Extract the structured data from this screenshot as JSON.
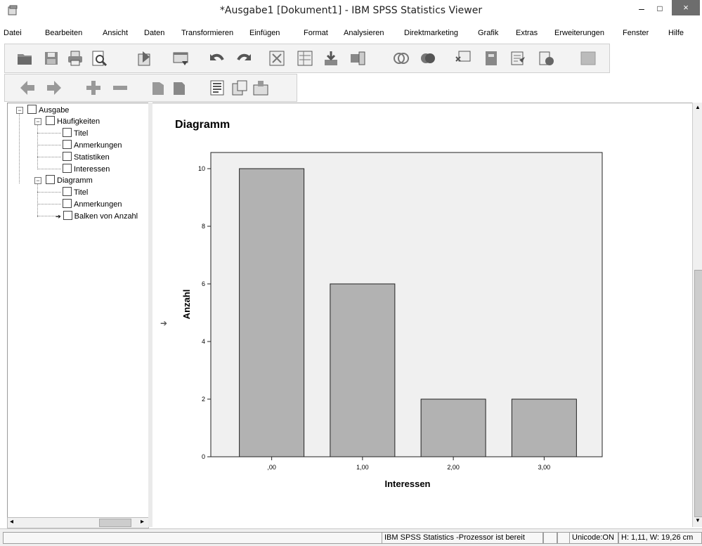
{
  "window": {
    "title": "*Ausgabe1 [Dokument1] - IBM SPSS Statistics Viewer",
    "minimize": "–",
    "maximize": "□",
    "close": "×"
  },
  "menu": [
    "Datei",
    "Bearbeiten",
    "Ansicht",
    "Daten",
    "Transformieren",
    "Einfügen",
    "Format",
    "Analysieren",
    "Direktmarketing",
    "Grafik",
    "Extras",
    "Erweiterungen",
    "Fenster",
    "Hilfe"
  ],
  "toolbar1_icons": [
    "open-icon",
    "save-icon",
    "print-icon",
    "print-preview-icon",
    "export-icon",
    "recall-dialog-icon",
    "undo-icon",
    "redo-icon",
    "goto-data-icon",
    "goto-case-icon",
    "insert-table-icon",
    "variables-icon",
    "select-cases-icon",
    "show-all-icon",
    "value-labels-icon",
    "designate-window-icon",
    "script-icon",
    "run-icon",
    "disabled-icon"
  ],
  "toolbar2_icons": [
    "promote-icon",
    "demote-icon",
    "expand-icon",
    "collapse-icon",
    "show-icon",
    "hide-icon",
    "insert-heading-icon",
    "insert-title-icon",
    "insert-text-icon"
  ],
  "outline": {
    "root": "Ausgabe",
    "groups": [
      {
        "label": "Häufigkeiten",
        "items": [
          "Titel",
          "Anmerkungen",
          "Statistiken",
          "Interessen"
        ]
      },
      {
        "label": "Diagramm",
        "items": [
          "Titel",
          "Anmerkungen",
          "Balken von Anzahl"
        ]
      }
    ]
  },
  "content": {
    "heading": "Diagramm"
  },
  "chart_data": {
    "type": "bar",
    "categories": [
      ",00",
      "1,00",
      "2,00",
      "3,00"
    ],
    "values": [
      10,
      6,
      2,
      2
    ],
    "xlabel": "Interessen",
    "ylabel": "Anzahl",
    "ylim": [
      0,
      10
    ],
    "yticks": [
      "0",
      "2",
      "4",
      "6",
      "8",
      "10"
    ],
    "colors": {
      "bar": "#b2b2b2",
      "plot_bg": "#f0f0f0",
      "bar_border": "#222222"
    }
  },
  "status": {
    "processor": "IBM SPSS Statistics -Prozessor ist bereit",
    "unicode": "Unicode:ON",
    "size": "H: 1,11, W: 19,26 cm"
  }
}
